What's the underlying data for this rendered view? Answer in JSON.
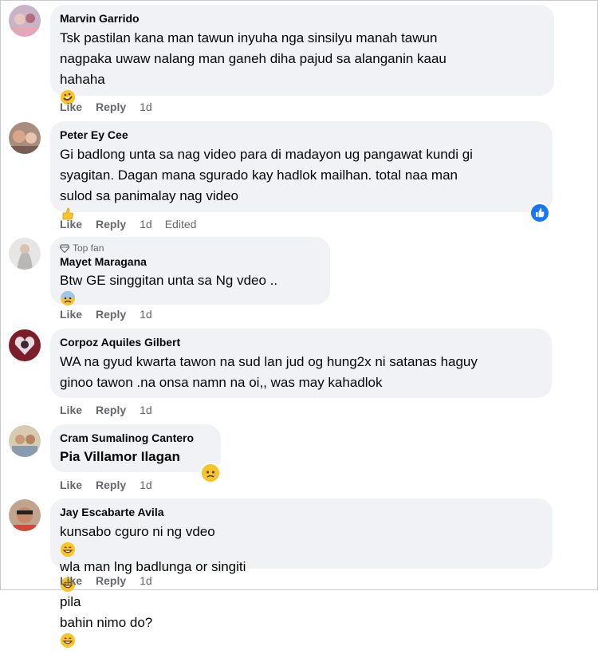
{
  "comments": [
    {
      "author": "Marvin Garrido",
      "lines": [
        "Tsk pastilan kana man tawun inyuha nga sinsilyu manah tawun",
        "nagpaka uwaw nalang man ganeh diha pajud sa alanganin kaau",
        "hahaha"
      ],
      "like": "Like",
      "reply": "Reply",
      "time": "1d"
    },
    {
      "author": "Peter Ey Cee",
      "lines": [
        "Gi badlong unta sa nag video para di madayon ug pangawat kundi gi",
        "syagitan. Dagan mana sgurado kay hadlok mailhan. total naa man",
        "sulod sa panimalay nag video"
      ],
      "like": "Like",
      "reply": "Reply",
      "time": "1d",
      "edited": "Edited"
    },
    {
      "badge": "Top fan",
      "author": "Mayet Maragana",
      "lines": [
        "Btw GE singgitan unta sa Ng vdeo .."
      ],
      "like": "Like",
      "reply": "Reply",
      "time": "1d"
    },
    {
      "author": "Corpoz Aquiles Gilbert",
      "lines": [
        "WA na gyud kwarta tawon na sud lan jud og hung2x ni satanas haguy",
        "ginoo tawon .na onsa namn na oi,, was may kahadlok"
      ],
      "like": "Like",
      "reply": "Reply",
      "time": "1d"
    },
    {
      "author": "Cram Sumalinog Cantero",
      "lines": [
        "Pia Villamor Ilagan"
      ],
      "like": "Like",
      "reply": "Reply",
      "time": "1d"
    },
    {
      "author": "Jay Escabarte Avila",
      "lines": [
        "kunsabo cguro ni ng vdeo",
        " wla man lng badlunga or singiti",
        " pila",
        "bahin nimo do?"
      ],
      "like": "Like",
      "reply": "Reply",
      "time": "1d"
    }
  ],
  "colors": {
    "bubble": "#f0f2f5",
    "muted": "#65676b",
    "like_blue": "#1877f2"
  },
  "icons": [
    "rofl-emoji",
    "thumbs-up-emoji",
    "cold-sweat-emoji",
    "grinning-emoji",
    "like-reaction-icon",
    "sad-reaction-icon",
    "diamond-icon"
  ]
}
